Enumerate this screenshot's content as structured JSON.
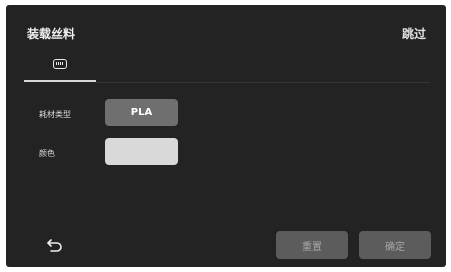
{
  "header": {
    "title": "装载丝料",
    "skip_label": "跳过"
  },
  "tabs": [
    {
      "icon": "filament-spool-icon",
      "active": true
    }
  ],
  "form": {
    "material_label": "耗材类型",
    "material_value": "PLA",
    "color_label": "颜色",
    "color_value": "#d9d9d9"
  },
  "footer": {
    "back_icon": "back-arrow-icon",
    "reset_label": "重置",
    "confirm_label": "确定"
  },
  "colors": {
    "background": "#232323",
    "button_disabled": "#5c5c5c",
    "material_button": "#6f6f6f"
  }
}
